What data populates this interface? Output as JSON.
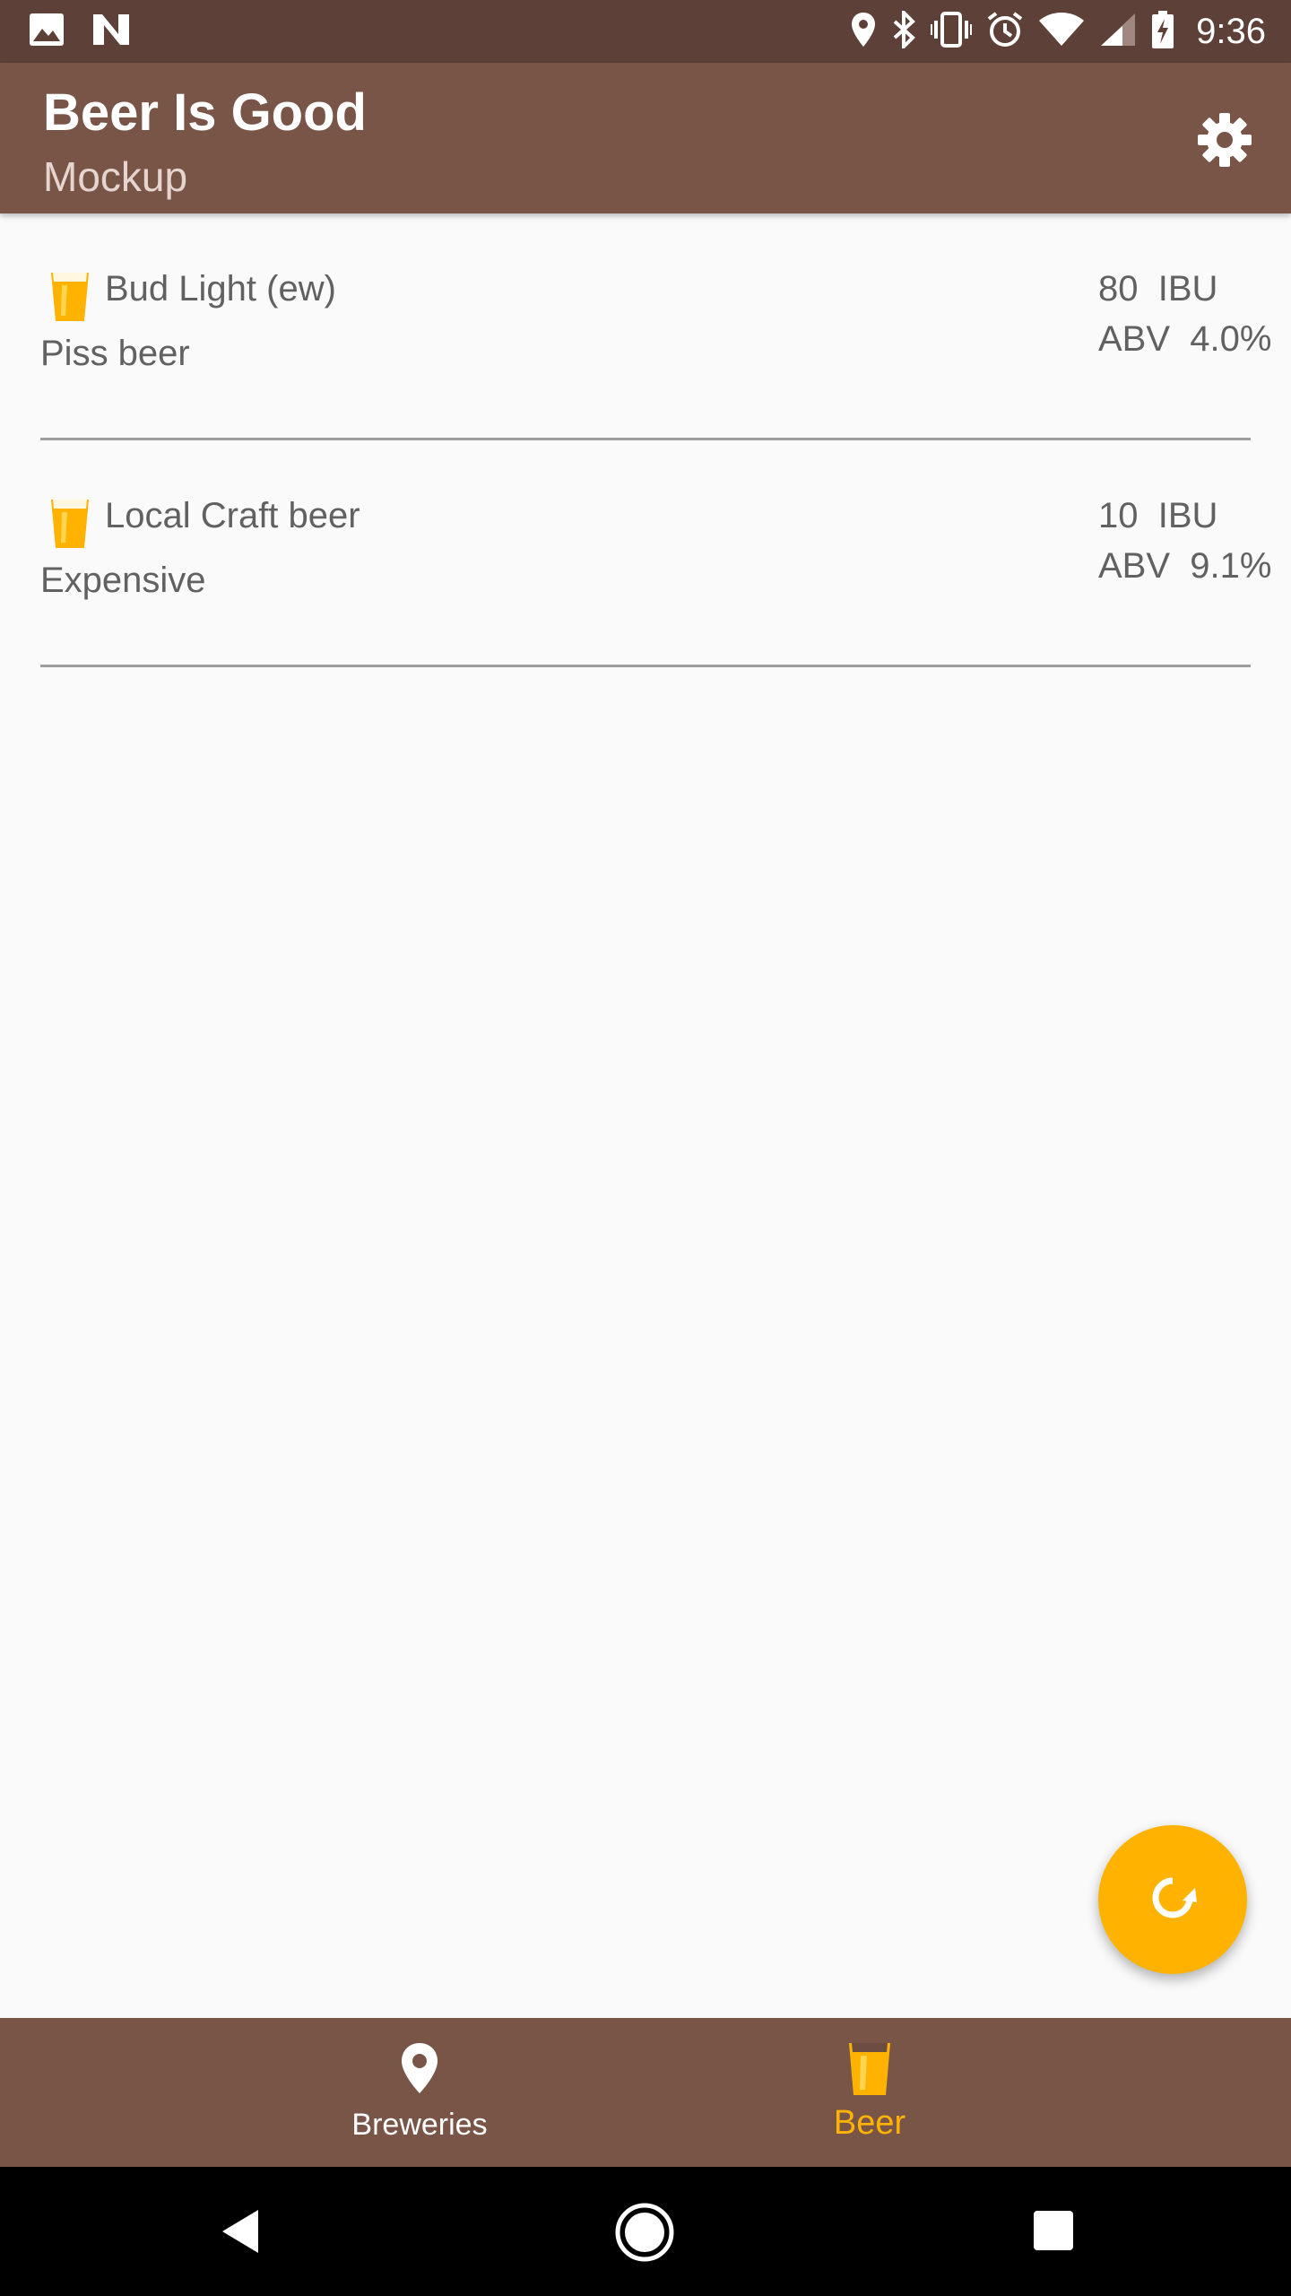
{
  "status_bar": {
    "time": "9:36",
    "left_icons": [
      "image-icon",
      "n-icon"
    ],
    "right_icons": [
      "location-icon",
      "bluetooth-icon",
      "vibrate-icon",
      "alarm-icon",
      "wifi-icon",
      "signal-icon",
      "battery-icon"
    ]
  },
  "app_bar": {
    "title": "Beer Is Good",
    "subtitle": "Mockup",
    "settings_icon": "gear-icon"
  },
  "beers": [
    {
      "name": "Bud Light (ew)",
      "description": "Piss beer",
      "ibu": "80  IBU",
      "abv": "ABV  4.0%"
    },
    {
      "name": "Local Craft beer",
      "description": "Expensive",
      "ibu": "10  IBU",
      "abv": "ABV  9.1%"
    }
  ],
  "fab": {
    "icon": "refresh-icon"
  },
  "bottom_nav": {
    "items": [
      {
        "label": "Breweries",
        "icon": "location-pin-icon",
        "active": false
      },
      {
        "label": "Beer",
        "icon": "beer-glass-icon",
        "active": true
      }
    ]
  },
  "colors": {
    "primary": "#795548",
    "primary_dark": "#5d4037",
    "accent": "#ffb300",
    "text_secondary": "#616161"
  }
}
